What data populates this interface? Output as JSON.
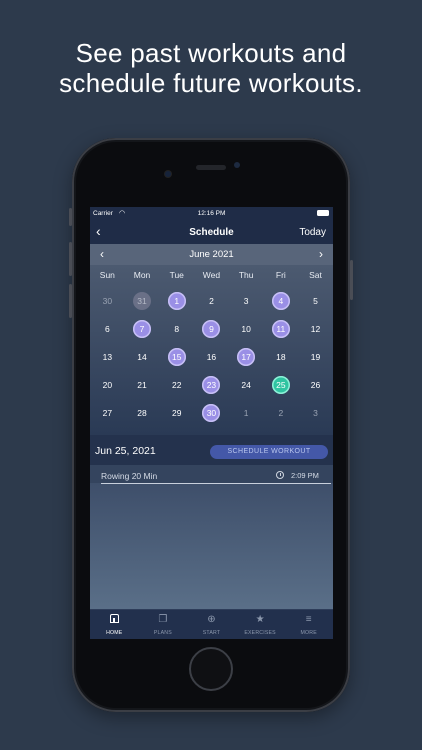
{
  "headline": {
    "line1": "See past workouts and",
    "line2": "schedule future workouts."
  },
  "status_bar": {
    "carrier": "Carrier",
    "time": "12:16 PM"
  },
  "nav": {
    "title": "Schedule",
    "today_label": "Today"
  },
  "calendar": {
    "month_label": "June 2021",
    "weekdays": [
      "Sun",
      "Mon",
      "Tue",
      "Wed",
      "Thu",
      "Fri",
      "Sat"
    ],
    "weeks": [
      [
        {
          "label": "30",
          "state": "muted"
        },
        {
          "label": "31",
          "state": "done-muted"
        },
        {
          "label": "1",
          "state": "done"
        },
        {
          "label": "2",
          "state": "normal"
        },
        {
          "label": "3",
          "state": "normal"
        },
        {
          "label": "4",
          "state": "done"
        },
        {
          "label": "5",
          "state": "normal"
        }
      ],
      [
        {
          "label": "6",
          "state": "normal"
        },
        {
          "label": "7",
          "state": "done"
        },
        {
          "label": "8",
          "state": "normal"
        },
        {
          "label": "9",
          "state": "done"
        },
        {
          "label": "10",
          "state": "normal"
        },
        {
          "label": "11",
          "state": "done"
        },
        {
          "label": "12",
          "state": "normal"
        }
      ],
      [
        {
          "label": "13",
          "state": "normal"
        },
        {
          "label": "14",
          "state": "normal"
        },
        {
          "label": "15",
          "state": "done"
        },
        {
          "label": "16",
          "state": "normal"
        },
        {
          "label": "17",
          "state": "done"
        },
        {
          "label": "18",
          "state": "normal"
        },
        {
          "label": "19",
          "state": "normal"
        }
      ],
      [
        {
          "label": "20",
          "state": "normal"
        },
        {
          "label": "21",
          "state": "normal"
        },
        {
          "label": "22",
          "state": "normal"
        },
        {
          "label": "23",
          "state": "done"
        },
        {
          "label": "24",
          "state": "normal"
        },
        {
          "label": "25",
          "state": "selected"
        },
        {
          "label": "26",
          "state": "normal"
        }
      ],
      [
        {
          "label": "27",
          "state": "normal"
        },
        {
          "label": "28",
          "state": "normal"
        },
        {
          "label": "29",
          "state": "normal"
        },
        {
          "label": "30",
          "state": "done"
        },
        {
          "label": "1",
          "state": "muted"
        },
        {
          "label": "2",
          "state": "muted"
        },
        {
          "label": "3",
          "state": "muted"
        }
      ]
    ]
  },
  "selected_day": {
    "date_label": "Jun 25, 2021",
    "schedule_button": "SCHEDULE WORKOUT",
    "workouts": [
      {
        "name": "Rowing 20 Min",
        "time": "2:09 PM"
      }
    ]
  },
  "tab_bar": {
    "tabs": [
      {
        "label": "HOME",
        "icon": "home-icon",
        "active": true
      },
      {
        "label": "PLANS",
        "icon": "document-icon",
        "active": false
      },
      {
        "label": "START",
        "icon": "plus-circle-icon",
        "active": false
      },
      {
        "label": "EXERCISES",
        "icon": "runner-icon",
        "active": false
      },
      {
        "label": "MORE",
        "icon": "menu-icon",
        "active": false
      }
    ]
  },
  "colors": {
    "background": "#2d3a4c",
    "completed_day": "#9a8fe6",
    "selected_day": "#2fc4a1",
    "schedule_button": "#4458a8"
  }
}
